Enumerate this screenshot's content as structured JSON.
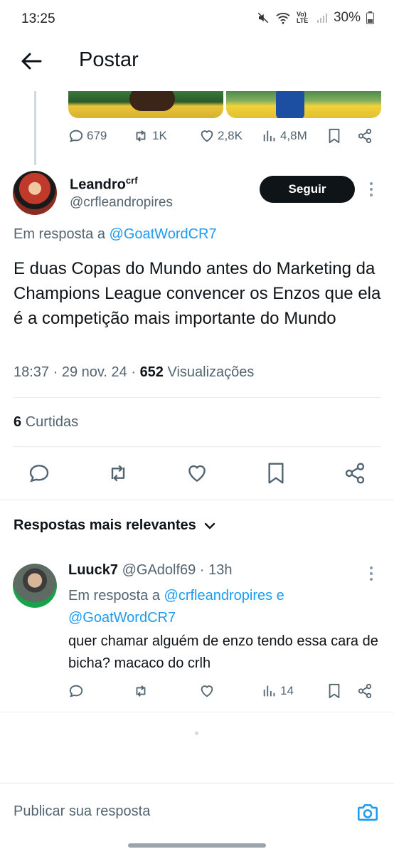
{
  "status_bar": {
    "time": "13:25",
    "battery": "30%",
    "network": "Vo) LTE"
  },
  "header": {
    "title": "Postar"
  },
  "parent_tweet_actions": {
    "replies": "679",
    "retweets": "1K",
    "likes": "2,8K",
    "views": "4,8M"
  },
  "tweet": {
    "author_name": "Leandro",
    "author_sup": "crf",
    "handle": "@crfleandropires",
    "follow_label": "Seguir",
    "reply_prefix": "Em resposta a",
    "reply_to": "@GoatWordCR7",
    "text": "E duas Copas do Mundo antes do Marketing da Champions League convencer os Enzos que ela é a competição mais importante do Mundo",
    "time": "18:37",
    "date": "29 nov. 24",
    "views_count": "652",
    "views_label": "Visualizações",
    "likes_count": "6",
    "likes_label": "Curtidas"
  },
  "sort": {
    "label": "Respostas mais relevantes"
  },
  "reply": {
    "name": "Luuck7",
    "handle": "@GAdolf69",
    "age": "13h",
    "reply_prefix": "Em resposta a",
    "reply_to_1": "@crfleandropires",
    "conjunction": "e",
    "reply_to_2": "@GoatWordCR7",
    "text": "quer chamar alguém de enzo tendo essa cara de bicha? macaco do crlh",
    "views": "14"
  },
  "composer": {
    "placeholder": "Publicar sua resposta"
  },
  "colors": {
    "link": "#1d9bf0",
    "muted": "#536471",
    "text": "#0f1419"
  },
  "icons": [
    "back-arrow-icon",
    "reply-icon",
    "retweet-icon",
    "heart-icon",
    "views-icon",
    "bookmark-icon",
    "share-icon",
    "chevron-down-icon",
    "camera-icon",
    "more-icon"
  ]
}
